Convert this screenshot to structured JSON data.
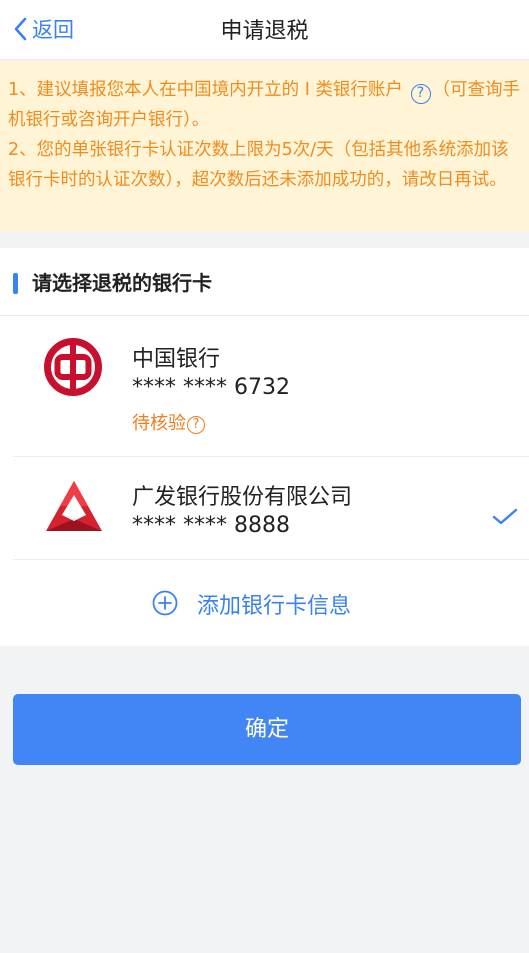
{
  "navbar": {
    "back_label": "返回",
    "title": "申请退税",
    "back_icon": "chevron-left-icon"
  },
  "notice": {
    "line1_before_help": "1、建议填报您本人在中国境内开立的 I 类银行账户",
    "help_glyph": "?",
    "line1_after_help": "（可查询手机银行或咨询开户银行）。",
    "line2": "2、您的单张银行卡认证次数上限为5次/天（包括其他系统添加该银行卡时的认证次数），超次数后还未添加成功的，请改日再试。"
  },
  "section": {
    "title": "请选择退税的银行卡"
  },
  "banks": [
    {
      "name": "中国银行",
      "number": "**** **** 6732",
      "status": "待核验",
      "status_help_glyph": "?",
      "logo_icon": "bank-of-china-logo-icon",
      "selected": false
    },
    {
      "name": "广发银行股份有限公司",
      "number": "**** **** 8888",
      "logo_icon": "cgb-logo-icon",
      "selected": true
    }
  ],
  "add_card": {
    "label": "添加银行卡信息",
    "icon": "plus-circle-icon"
  },
  "confirm_button": {
    "label": "确定"
  },
  "colors": {
    "accent": "#3a82f0",
    "notice_bg": "#fff4d6",
    "notice_text": "#f08c1e",
    "status_orange": "#f07d1e",
    "boc_red": "#c8102e",
    "cgb_red": "#d6212f",
    "button_blue": "#4285f4"
  }
}
